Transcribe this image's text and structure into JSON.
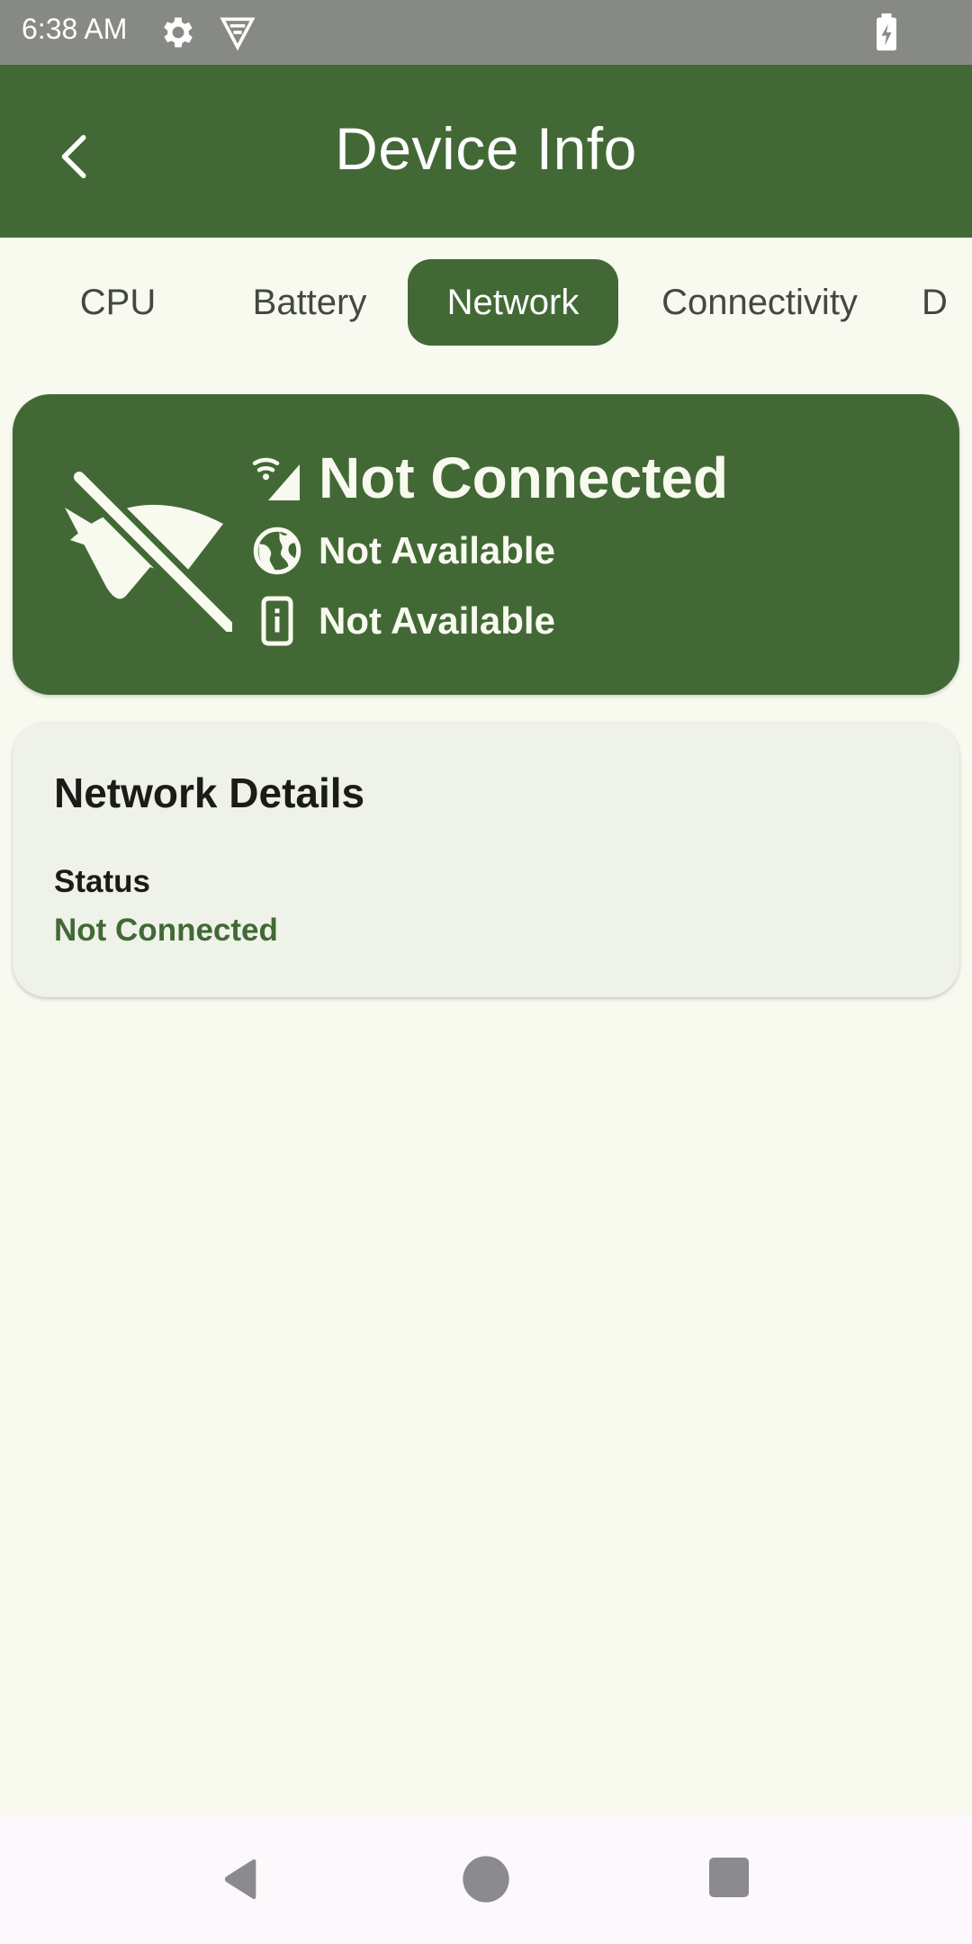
{
  "status_bar": {
    "time": "6:38 AM",
    "icons": [
      "gear-icon",
      "vpn-icon",
      "battery-charging-icon"
    ]
  },
  "app_bar": {
    "title": "Device Info",
    "back_icon": "chevron-left-icon"
  },
  "tabs": [
    {
      "label": "CPU",
      "selected": false
    },
    {
      "label": "Battery",
      "selected": false
    },
    {
      "label": "Network",
      "selected": true
    },
    {
      "label": "Connectivity",
      "selected": false
    },
    {
      "label": "D",
      "selected": false
    }
  ],
  "summary": {
    "status": "Not Connected",
    "ip": "Not Available",
    "device": "Not Available",
    "icons": [
      "wifi-off-icon",
      "signal-wifi-icon",
      "globe-icon",
      "phone-info-icon"
    ]
  },
  "details": {
    "title": "Network Details",
    "status_label": "Status",
    "status_value": "Not Connected"
  },
  "colors": {
    "primary": "#426935",
    "background": "#f8faf0",
    "card": "#eff2e8",
    "status_bar": "#878a84"
  }
}
